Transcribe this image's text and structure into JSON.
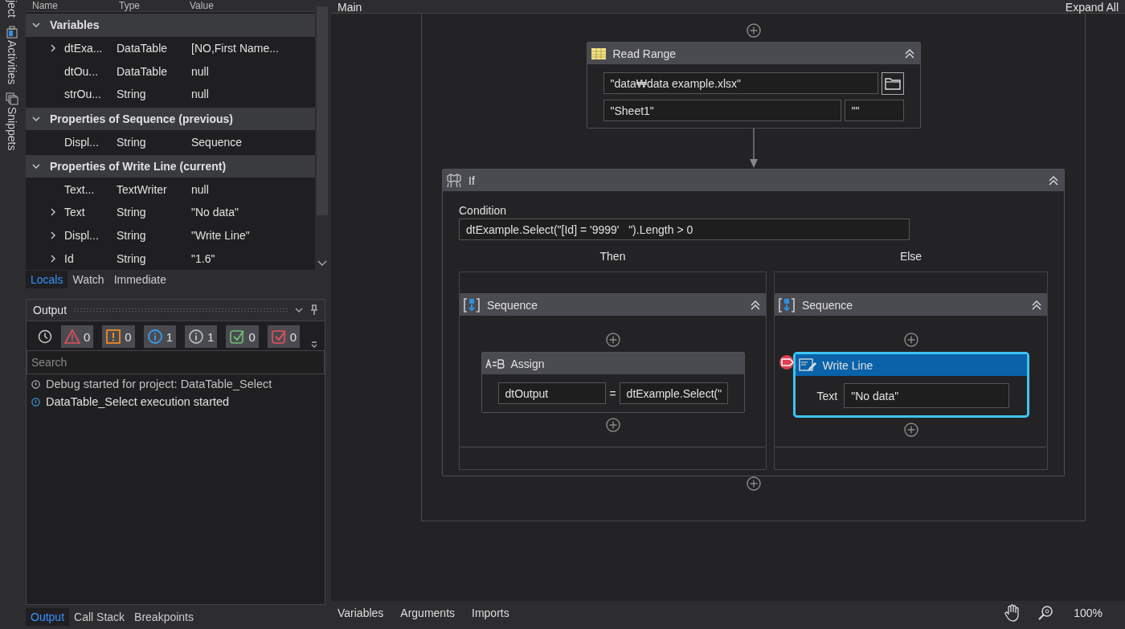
{
  "side_tabs": [
    {
      "label": "ject",
      "kind": "object"
    },
    {
      "label": "Activities",
      "kind": "activities"
    },
    {
      "label": "Snippets",
      "kind": "snippets"
    }
  ],
  "locals": {
    "columns": [
      "Name",
      "Type",
      "Value"
    ],
    "groups": [
      {
        "title": "Variables",
        "expanded": true,
        "rows": [
          {
            "name": "dtExa...",
            "type": "DataTable",
            "value": "[NO,First Name...",
            "expandable": true
          },
          {
            "name": "dtOu...",
            "type": "DataTable",
            "value": "null",
            "expandable": false
          },
          {
            "name": "strOu...",
            "type": "String",
            "value": "null",
            "expandable": false
          }
        ]
      },
      {
        "title": "Properties of Sequence (previous)",
        "expanded": true,
        "rows": [
          {
            "name": "Displ...",
            "type": "String",
            "value": "Sequence",
            "expandable": false
          }
        ]
      },
      {
        "title": "Properties of Write Line (current)",
        "expanded": true,
        "rows": [
          {
            "name": "Text...",
            "type": "TextWriter",
            "value": "null",
            "expandable": false
          },
          {
            "name": "Text",
            "type": "String",
            "value": "\"No data\"",
            "expandable": true
          },
          {
            "name": "Displ...",
            "type": "String",
            "value": "\"Write Line\"",
            "expandable": true
          },
          {
            "name": "Id",
            "type": "String",
            "value": "\"1.6\"",
            "expandable": true
          }
        ]
      }
    ],
    "tabs": [
      {
        "label": "Locals",
        "selected": true
      },
      {
        "label": "Watch",
        "selected": false
      },
      {
        "label": "Immediate",
        "selected": false
      }
    ]
  },
  "output": {
    "title": "Output",
    "filters": [
      {
        "kind": "error",
        "count": "0"
      },
      {
        "kind": "warning",
        "count": "0"
      },
      {
        "kind": "info",
        "count": "1"
      },
      {
        "kind": "trace",
        "count": "1"
      },
      {
        "kind": "success",
        "count": "0"
      },
      {
        "kind": "fail",
        "count": "0"
      }
    ],
    "search": {
      "placeholder": "Search"
    },
    "lines": [
      {
        "kind": "trace",
        "text": "Debug started for project: DataTable_Select"
      },
      {
        "kind": "info",
        "text": "DataTable_Select execution started"
      }
    ],
    "tabs": [
      {
        "label": "Output",
        "selected": true
      },
      {
        "label": "Call Stack",
        "selected": false
      },
      {
        "label": "Breakpoints",
        "selected": false
      }
    ]
  },
  "designer": {
    "title": "Main",
    "expand_all": "Expand All",
    "read_range": {
      "title": "Read Range",
      "path": "\"data₩data example.xlsx\"",
      "sheet": "\"Sheet1\"",
      "range": "\"\""
    },
    "if": {
      "title": "If",
      "condition_label": "Condition",
      "condition": "dtExample.Select(\"[Id] = '9999'   \").Length > 0",
      "then_label": "Then",
      "else_label": "Else",
      "then": {
        "title": "Sequence",
        "assign": {
          "title": "Assign",
          "to": "dtOutput",
          "operator": "=",
          "value": "dtExample.Select(\""
        }
      },
      "else": {
        "title": "Sequence",
        "write_line": {
          "title": "Write Line",
          "text_label": "Text",
          "text": "\"No data\"",
          "selected": true,
          "breakpoint": true
        }
      }
    },
    "bottom_tabs": [
      "Variables",
      "Arguments",
      "Imports"
    ],
    "zoom": "100%"
  }
}
